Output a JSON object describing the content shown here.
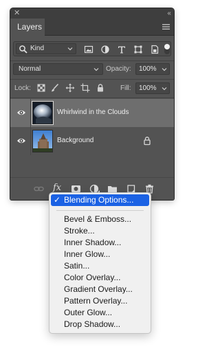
{
  "panel": {
    "title": "Layers",
    "filter": {
      "kind_label": "Kind"
    },
    "blend_mode": "Normal",
    "opacity_label": "Opacity:",
    "opacity_value": "100%",
    "lock_label": "Lock:",
    "fill_label": "Fill:",
    "fill_value": "100%",
    "layers": [
      {
        "name": "Whirlwind in the Clouds",
        "selected": true,
        "visible": true,
        "locked": false
      },
      {
        "name": "Background",
        "selected": false,
        "visible": true,
        "locked": true
      }
    ]
  },
  "fx_label": "fx",
  "menu": {
    "selected_item": "Blending Options...",
    "check": "✓",
    "items": [
      "Bevel & Emboss...",
      "Stroke...",
      "Inner Shadow...",
      "Inner Glow...",
      "Satin...",
      "Color Overlay...",
      "Gradient Overlay...",
      "Pattern Overlay...",
      "Outer Glow...",
      "Drop Shadow..."
    ]
  },
  "colors": {
    "panel_bg": "#535353",
    "selected_layer": "#6e6e6e",
    "menu_highlight": "#1b62e4",
    "menu_bg": "#f0f0f0"
  }
}
